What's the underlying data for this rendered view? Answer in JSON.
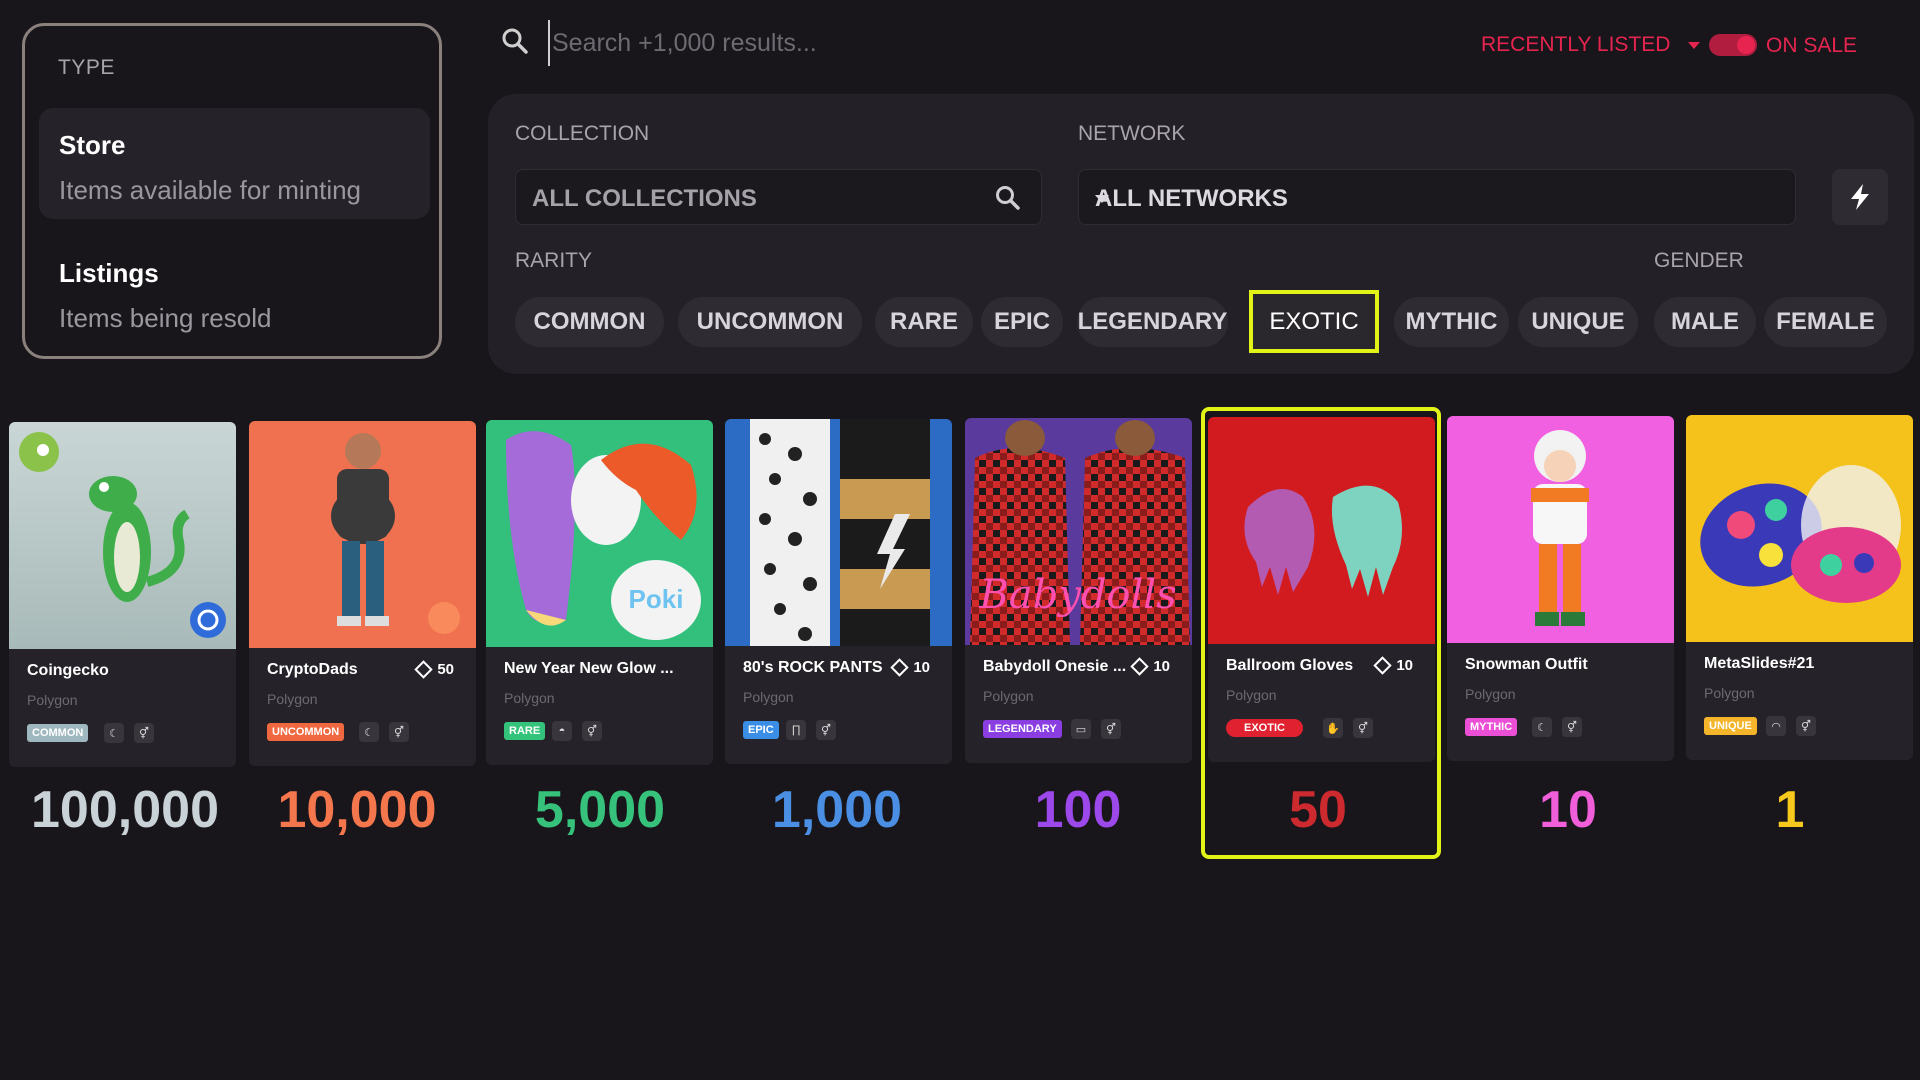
{
  "type_filter": {
    "heading": "TYPE",
    "options": [
      {
        "title": "Store",
        "subtitle": "Items available for minting"
      },
      {
        "title": "Listings",
        "subtitle": "Items being resold"
      }
    ]
  },
  "search": {
    "placeholder": "Search +1,000 results..."
  },
  "sort": {
    "label": "RECENTLY LISTED"
  },
  "on_sale": {
    "label": "ON SALE",
    "enabled": true
  },
  "filters": {
    "collection_label": "COLLECTION",
    "collection_value": "ALL COLLECTIONS",
    "network_label": "NETWORK",
    "network_value": "ALL NETWORKS",
    "rarity_label": "RARITY",
    "gender_label": "GENDER",
    "rarity_pills": [
      "COMMON",
      "UNCOMMON",
      "RARE",
      "EPIC",
      "LEGENDARY",
      "EXOTIC",
      "MYTHIC",
      "UNIQUE"
    ],
    "gender_pills": [
      "MALE",
      "FEMALE"
    ],
    "selected_rarity": "EXOTIC"
  },
  "cards": [
    {
      "name": "Coingecko",
      "stock": "",
      "network": "Polygon",
      "rarity": "COMMON",
      "rarity_color": "#9fb7bf",
      "amount": "100,000",
      "amount_color": "#c9d2d6",
      "icon": "moon-icon"
    },
    {
      "name": "CryptoDads",
      "stock": "50",
      "network": "Polygon",
      "rarity": "UNCOMMON",
      "rarity_color": "#f0683f",
      "amount": "10,000",
      "amount_color": "#f4764d",
      "icon": "moon-icon"
    },
    {
      "name": "New Year New Glow ...",
      "stock": "",
      "network": "Polygon",
      "rarity": "RARE",
      "rarity_color": "#34c37a",
      "amount": "5,000",
      "amount_color": "#37c27c",
      "icon": "hair-icon"
    },
    {
      "name": "80's ROCK PANTS",
      "stock": "10",
      "network": "Polygon",
      "rarity": "EPIC",
      "rarity_color": "#3a8ee6",
      "amount": "1,000",
      "amount_color": "#4a8fe3",
      "icon": "pants-icon"
    },
    {
      "name": "Babydoll Onesie ...",
      "stock": "10",
      "network": "Polygon",
      "rarity": "LEGENDARY",
      "rarity_color": "#8a3de0",
      "amount": "100",
      "amount_color": "#9c48ea",
      "icon": "outfit-icon"
    },
    {
      "name": "Ballroom Gloves",
      "stock": "10",
      "network": "Polygon",
      "rarity": "EXOTIC",
      "rarity_color": "#e0212f",
      "amount": "50",
      "amount_color": "#cd2a2f",
      "icon": "hand-icon"
    },
    {
      "name": "Snowman Outfit",
      "stock": "",
      "network": "Polygon",
      "rarity": "MYTHIC",
      "rarity_color": "#ea4fd6",
      "amount": "10",
      "amount_color": "#f05ed9",
      "icon": "moon-icon"
    },
    {
      "name": "MetaSlides#21",
      "stock": "",
      "network": "Polygon",
      "rarity": "UNIQUE",
      "rarity_color": "#f4b52a",
      "amount": "1",
      "amount_color": "#f6c91c",
      "icon": "shoe-icon"
    }
  ]
}
